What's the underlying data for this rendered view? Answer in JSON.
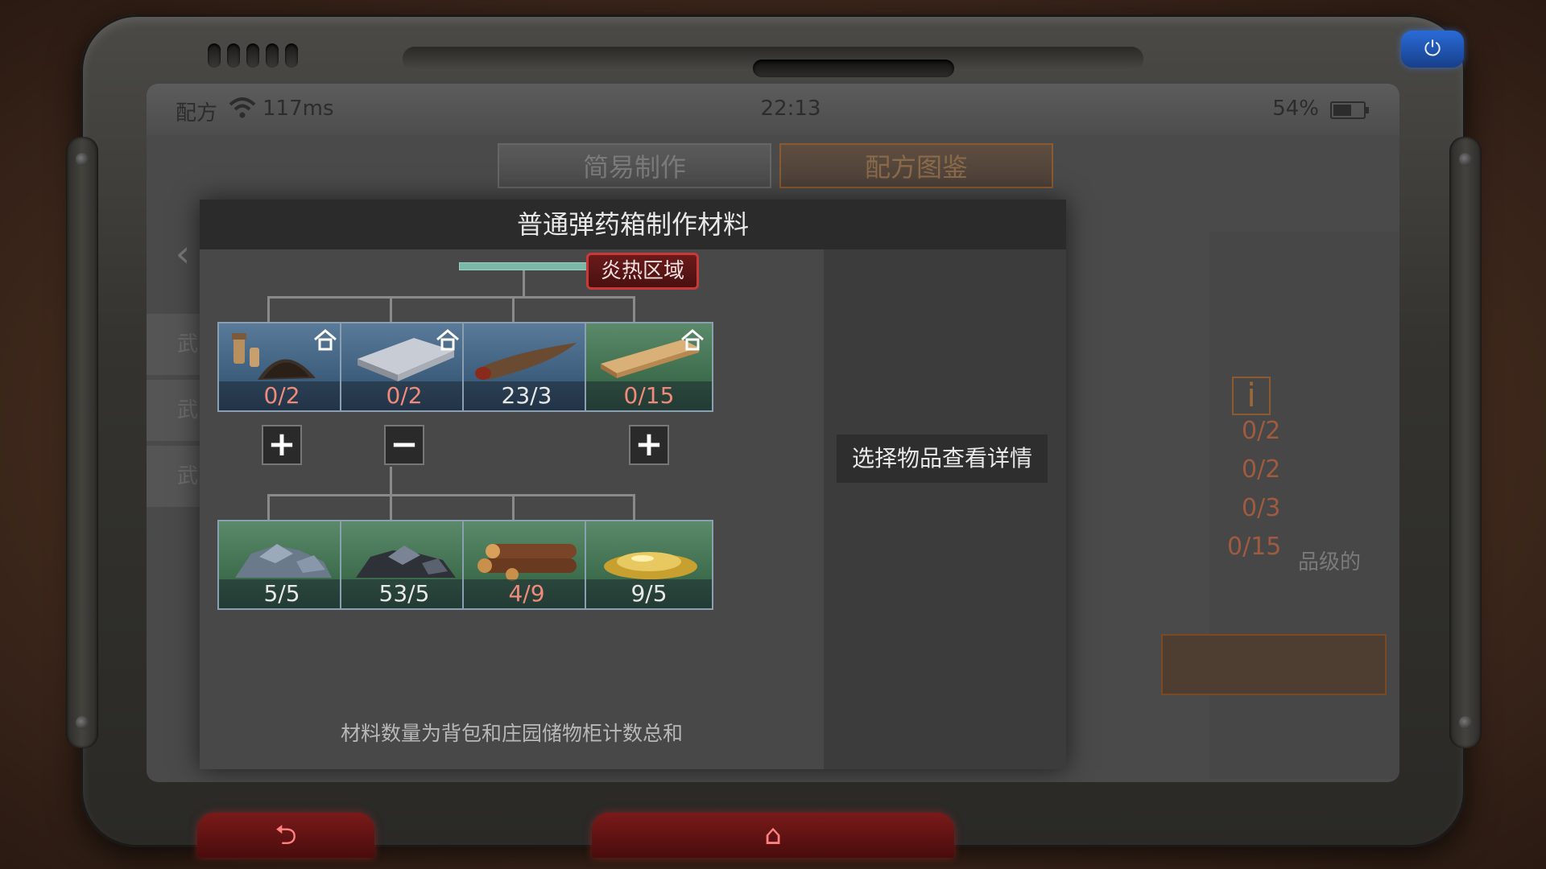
{
  "status_bar": {
    "app_name": "配方",
    "ping": "117ms",
    "time": "22:13",
    "battery": "54%"
  },
  "background_page": {
    "tabs": [
      "简易制作",
      "配方图鉴"
    ],
    "back_glyph": "‹",
    "side_items": [
      "武",
      "武",
      "武"
    ],
    "right_counts": [
      "0/2",
      "0/2",
      "0/3",
      "0/15"
    ],
    "right_text": "品级的",
    "info_glyph": "i"
  },
  "modal": {
    "title": "普通弹药箱制作材料",
    "zone_badge": "炎热区域",
    "detail_hint": "选择物品查看详情",
    "footnote": "材料数量为背包和庄园储物柜计数总和",
    "row1": [
      {
        "count": "0/2",
        "short": true,
        "home": true,
        "color": "blue",
        "icon": "gunpowder-icon",
        "toggle": "+"
      },
      {
        "count": "0/2",
        "short": true,
        "home": true,
        "color": "blue",
        "icon": "metal-plate-icon",
        "toggle": "−"
      },
      {
        "count": "23/3",
        "short": false,
        "home": false,
        "color": "blue",
        "icon": "horn-icon",
        "toggle": ""
      },
      {
        "count": "0/15",
        "short": true,
        "home": true,
        "color": "green",
        "icon": "wood-plank-icon",
        "toggle": "+"
      }
    ],
    "row2": [
      {
        "count": "5/5",
        "short": false,
        "color": "green",
        "icon": "iron-ore-icon"
      },
      {
        "count": "53/5",
        "short": false,
        "color": "green",
        "icon": "coal-ore-icon"
      },
      {
        "count": "4/9",
        "short": true,
        "color": "green",
        "icon": "logs-icon"
      },
      {
        "count": "9/5",
        "short": false,
        "color": "green",
        "icon": "resin-icon"
      }
    ]
  },
  "hardware": {
    "back_glyph": "⮌",
    "home_glyph": "⌂",
    "power_glyph": "⏻"
  }
}
